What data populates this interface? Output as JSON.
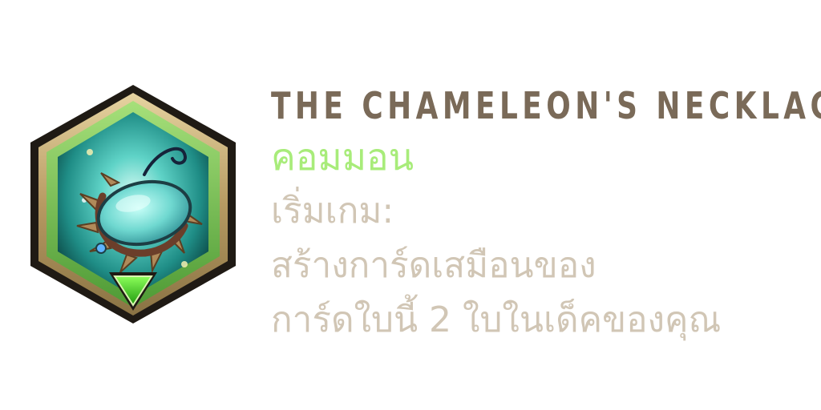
{
  "card": {
    "name": "THE CHAMELEON'S NECKLACE",
    "rarity": "คอมมอน",
    "description": [
      "เริ่มเกม:",
      "สร้างการ์ดเสมือนของ",
      "การ์ดใบนี้ 2 ใบในเด็คของคุณ"
    ]
  },
  "colors": {
    "name": "#7a6a58",
    "rarity": "#a8ec7a",
    "description": "#d1c6b5",
    "frame_outer": "#1f1a14",
    "frame_gold": "#c9b07a",
    "frame_green": "#7cc456",
    "gem_green": "#3fcf1e"
  },
  "icon": "chameleon-necklace-icon"
}
